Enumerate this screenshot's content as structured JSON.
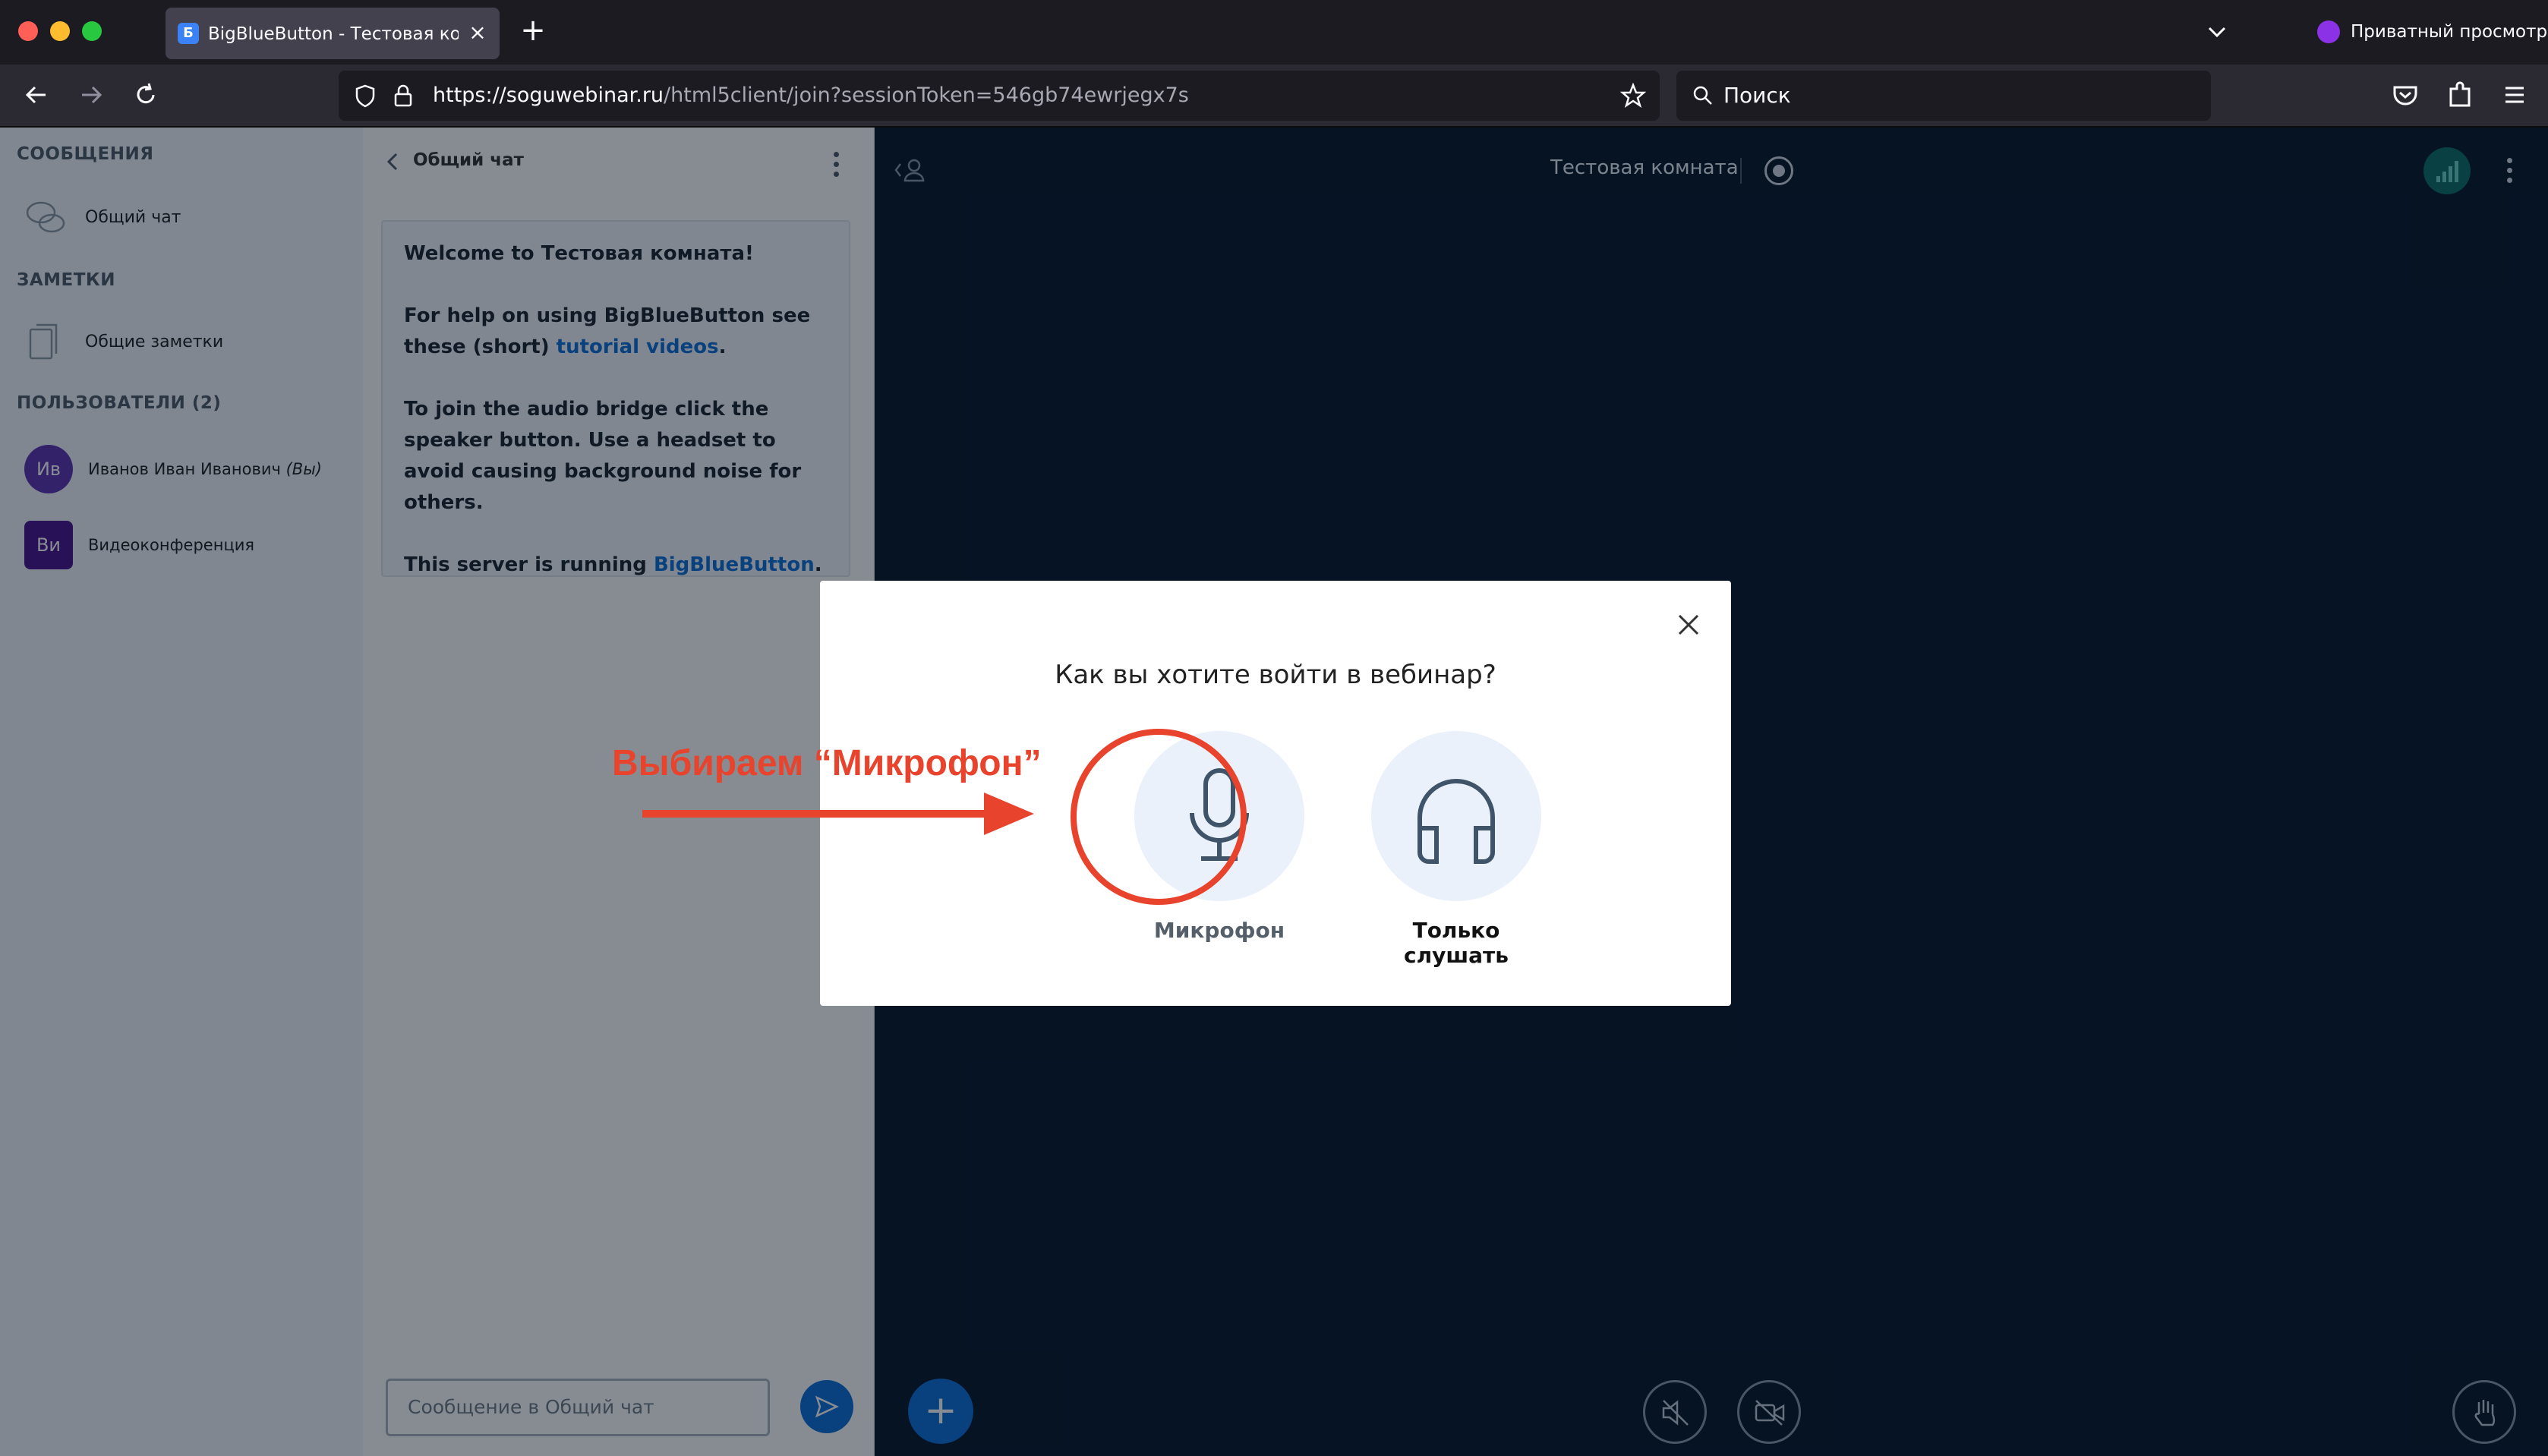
{
  "browser": {
    "tab_title": "BigBlueButton - Тестовая комната",
    "tab_favicon": "Б",
    "private_label": "Приватный просмотр",
    "url_host": "https://soguwebinar.ru",
    "url_path": "/html5client/join?sessionToken=546gb74ewrjegx7s",
    "search_placeholder": "Поиск"
  },
  "sidebar": {
    "messages_title": "СООБЩЕНИЯ",
    "public_chat": "Общий чат",
    "notes_title": "ЗАМЕТКИ",
    "shared_notes": "Общие заметки",
    "users_title": "ПОЛЬЗОВАТЕЛИ (2)",
    "users": [
      {
        "initials": "Ив",
        "name": "Иванов Иван Иванович",
        "suffix": "(Вы)"
      },
      {
        "initials": "Ви",
        "name": "Видеоконференция",
        "suffix": ""
      }
    ]
  },
  "chat": {
    "title": "Общий чат",
    "welcome_1": "Welcome to Тестовая комната!",
    "welcome_2a": "For help on using BigBlueButton see these (short) ",
    "welcome_2_link": "tutorial videos",
    "welcome_2b": ".",
    "welcome_3": "To join the audio bridge click the speaker button. Use a headset to avoid causing background noise for others.",
    "welcome_4a": "This server is running ",
    "welcome_4_link": "BigBlueButton",
    "welcome_4b": ".",
    "input_placeholder": "Сообщение в Общий чат"
  },
  "main": {
    "room_title": "Тестовая комната"
  },
  "modal": {
    "title": "Как вы хотите войти в вебинар?",
    "option_mic": "Микрофон",
    "option_listen": "Только слушать"
  },
  "annotation": {
    "text": "Выбираем “Микрофон”",
    "color": "#e8432d"
  }
}
